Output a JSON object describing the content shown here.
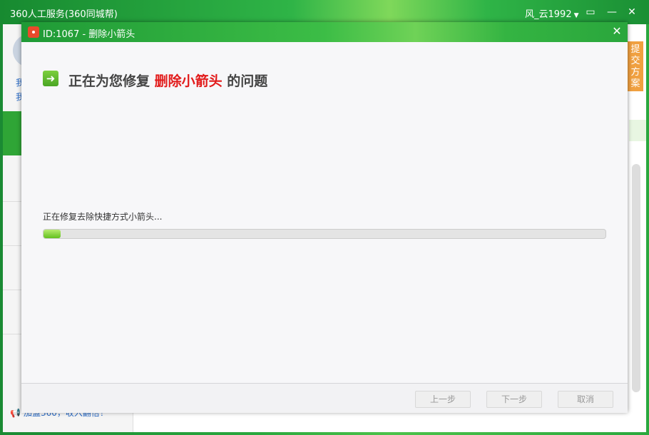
{
  "outer": {
    "title": "360人工服务(360同城帮)",
    "user": "风_云1992",
    "join_link": "加盟360，收入翻倍！",
    "submit_tab": "提交方案",
    "stub_lines": [
      "我",
      "我"
    ]
  },
  "dialog": {
    "title": "ID:1067 - 删除小箭头",
    "heading_prefix": "正在为您修复",
    "heading_highlight": "删除小箭头",
    "heading_suffix": "的问题",
    "status_text": "正在修复去除快捷方式小箭头...",
    "progress_fraction": 0.03,
    "buttons": {
      "prev": "上一步",
      "next": "下一步",
      "cancel": "取消"
    }
  },
  "colors": {
    "accent_green": "#2fa536",
    "highlight_red": "#e21b1b",
    "submit_orange": "#f0a040"
  }
}
